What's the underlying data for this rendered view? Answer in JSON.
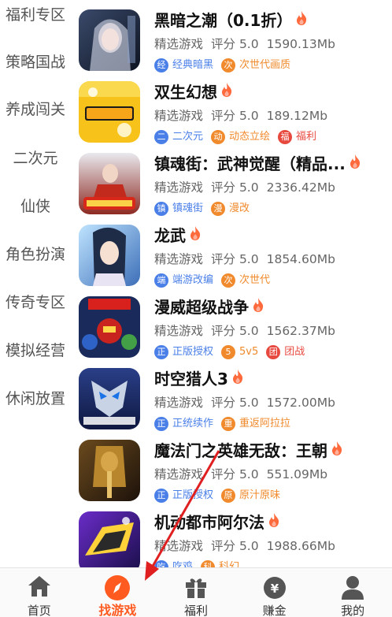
{
  "sidebar": {
    "items": [
      {
        "label": "福利专区"
      },
      {
        "label": "策略国战"
      },
      {
        "label": "养成闯关"
      },
      {
        "label": "二次元"
      },
      {
        "label": "仙侠"
      },
      {
        "label": "角色扮演"
      },
      {
        "label": "传奇专区"
      },
      {
        "label": "模拟经营"
      },
      {
        "label": "休闲放置"
      }
    ]
  },
  "games": [
    {
      "name": "黑暗之潮（0.1折）",
      "category": "精选游戏",
      "rating": "评分 5.0",
      "size": "1590.13Mb",
      "tags": [
        {
          "icon": "经",
          "label": "经典暗黑",
          "color": "#4a7fe8"
        },
        {
          "icon": "次",
          "label": "次世代画质",
          "color": "#f08a2c"
        }
      ]
    },
    {
      "name": "双生幻想",
      "category": "精选游戏",
      "rating": "评分 5.0",
      "size": "189.12Mb",
      "tags": [
        {
          "icon": "二",
          "label": "二次元",
          "color": "#4a7fe8"
        },
        {
          "icon": "动",
          "label": "动态立绘",
          "color": "#f08a2c"
        },
        {
          "icon": "福",
          "label": "福利",
          "color": "#e8493f"
        }
      ]
    },
    {
      "name": "镇魂街：武神觉醒（精品...",
      "category": "精选游戏",
      "rating": "评分 5.0",
      "size": "2336.42Mb",
      "tags": [
        {
          "icon": "镇",
          "label": "镇魂街",
          "color": "#4a7fe8"
        },
        {
          "icon": "漫",
          "label": "漫改",
          "color": "#f08a2c"
        }
      ]
    },
    {
      "name": "龙武",
      "category": "精选游戏",
      "rating": "评分 5.0",
      "size": "1854.60Mb",
      "tags": [
        {
          "icon": "端",
          "label": "端游改编",
          "color": "#4a7fe8"
        },
        {
          "icon": "次",
          "label": "次世代",
          "color": "#f08a2c"
        }
      ]
    },
    {
      "name": "漫威超级战争",
      "category": "精选游戏",
      "rating": "评分 5.0",
      "size": "1562.37Mb",
      "tags": [
        {
          "icon": "正",
          "label": "正版授权",
          "color": "#4a7fe8"
        },
        {
          "icon": "5",
          "label": "5v5",
          "color": "#f08a2c"
        },
        {
          "icon": "团",
          "label": "团战",
          "color": "#e8493f"
        }
      ]
    },
    {
      "name": "时空猎人3",
      "category": "精选游戏",
      "rating": "评分 5.0",
      "size": "1572.00Mb",
      "tags": [
        {
          "icon": "正",
          "label": "正统续作",
          "color": "#4a7fe8"
        },
        {
          "icon": "重",
          "label": "重返阿拉拉",
          "color": "#f08a2c"
        }
      ]
    },
    {
      "name": "魔法门之英雄无敌：王朝",
      "category": "精选游戏",
      "rating": "评分 5.0",
      "size": "551.09Mb",
      "tags": [
        {
          "icon": "正",
          "label": "正版授权",
          "color": "#4a7fe8"
        },
        {
          "icon": "原",
          "label": "原汁原味",
          "color": "#f08a2c"
        }
      ]
    },
    {
      "name": "机动都市阿尔法",
      "category": "精选游戏",
      "rating": "评分 5.0",
      "size": "1988.66Mb",
      "tags": [
        {
          "icon": "吃",
          "label": "吃鸡",
          "color": "#4a7fe8"
        },
        {
          "icon": "科",
          "label": "科幻",
          "color": "#f08a2c"
        }
      ]
    }
  ],
  "tabbar": {
    "tabs": [
      {
        "label": "首页",
        "icon": "home-icon"
      },
      {
        "label": "找游戏",
        "icon": "compass-icon",
        "active": true,
        "color": "#ff5a1f"
      },
      {
        "label": "福利",
        "icon": "gift-icon"
      },
      {
        "label": "赚金",
        "icon": "money-bag-icon"
      },
      {
        "label": "我的",
        "icon": "user-icon"
      }
    ]
  },
  "colors": {
    "accent": "#ff5a1f",
    "fire": "#ff6a3d",
    "annotation_arrow": "#e02020"
  }
}
